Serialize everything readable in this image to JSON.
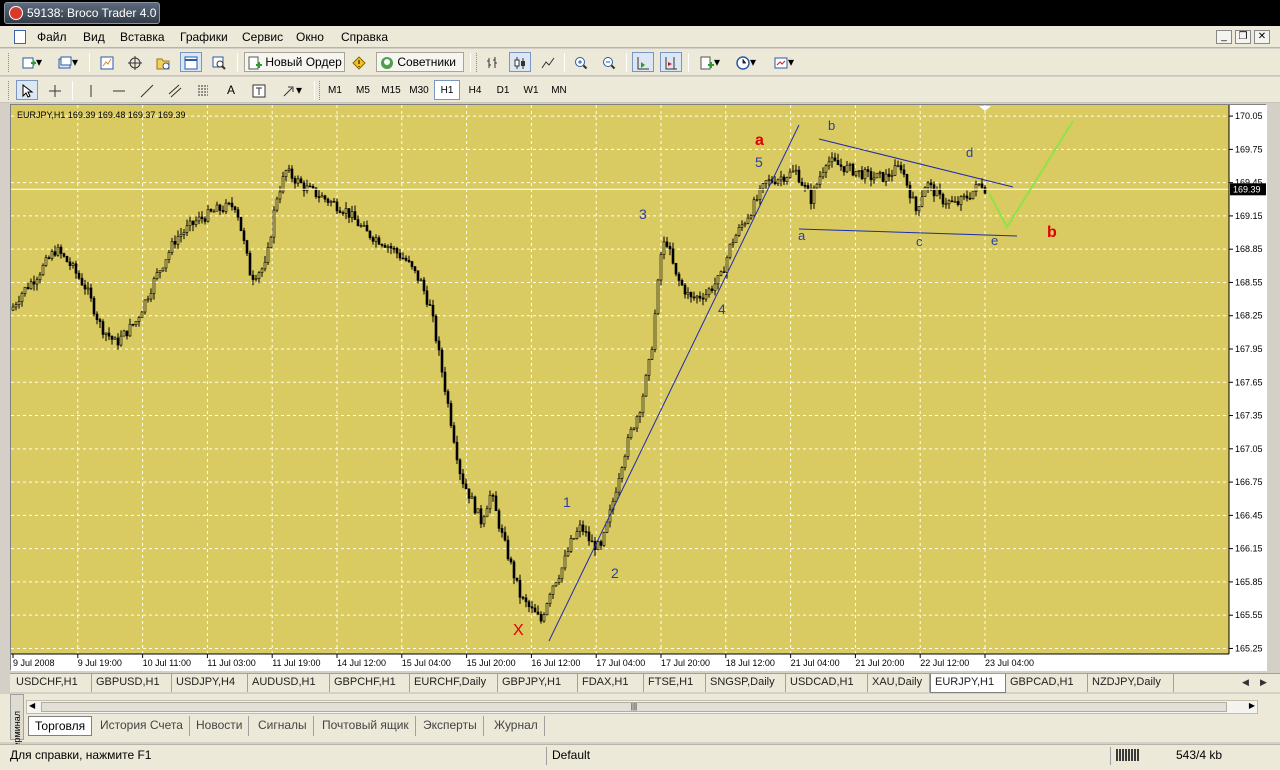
{
  "window": {
    "title": "59138: Broco Trader 4.0"
  },
  "menu": [
    "Файл",
    "Вид",
    "Вставка",
    "Графики",
    "Сервис",
    "Окно",
    "Справка"
  ],
  "toolbar": {
    "new_order": "Новый Ордер",
    "experts": "Советники"
  },
  "timeframes": [
    "M1",
    "M5",
    "M15",
    "M30",
    "H1",
    "H4",
    "D1",
    "W1",
    "MN"
  ],
  "active_timeframe": "H1",
  "chart_data": {
    "type": "candlestick",
    "header": "EURJPY,H1  169.39 169.48 169.37 169.39",
    "symbol": "EURJPY",
    "timeframe": "H1",
    "ohlc": {
      "open": 169.39,
      "high": 169.48,
      "low": 169.37,
      "close": 169.39
    },
    "current_price_label": "169.39",
    "y_ticks": [
      "170.05",
      "169.75",
      "169.45",
      "169.15",
      "168.85",
      "168.55",
      "168.25",
      "167.95",
      "167.65",
      "167.35",
      "167.05",
      "166.75",
      "166.45",
      "166.15",
      "165.85",
      "165.55",
      "165.25"
    ],
    "ylim": [
      165.2,
      170.15
    ],
    "x_ticks": [
      "9 Jul 2008",
      "9 Jul 19:00",
      "10 Jul 11:00",
      "11 Jul 03:00",
      "11 Jul 19:00",
      "14 Jul 12:00",
      "15 Jul 04:00",
      "15 Jul 20:00",
      "16 Jul 12:00",
      "17 Jul 04:00",
      "17 Jul 20:00",
      "18 Jul 12:00",
      "21 Jul 04:00",
      "21 Jul 20:00",
      "22 Jul 12:00",
      "23 Jul 04:00"
    ],
    "price_path": [
      [
        0,
        168.3
      ],
      [
        10,
        168.45
      ],
      [
        25,
        168.6
      ],
      [
        45,
        168.85
      ],
      [
        60,
        168.7
      ],
      [
        75,
        168.5
      ],
      [
        90,
        168.15
      ],
      [
        105,
        168.0
      ],
      [
        125,
        168.2
      ],
      [
        145,
        168.6
      ],
      [
        165,
        168.95
      ],
      [
        185,
        169.1
      ],
      [
        205,
        169.2
      ],
      [
        225,
        169.25
      ],
      [
        240,
        168.6
      ],
      [
        255,
        168.7
      ],
      [
        265,
        169.3
      ],
      [
        275,
        169.55
      ],
      [
        295,
        169.4
      ],
      [
        315,
        169.3
      ],
      [
        335,
        169.2
      ],
      [
        355,
        169.0
      ],
      [
        375,
        168.9
      ],
      [
        395,
        168.75
      ],
      [
        410,
        168.55
      ],
      [
        420,
        168.3
      ],
      [
        430,
        167.8
      ],
      [
        440,
        167.3
      ],
      [
        450,
        166.8
      ],
      [
        460,
        166.6
      ],
      [
        470,
        166.4
      ],
      [
        480,
        166.65
      ],
      [
        490,
        166.3
      ],
      [
        500,
        166.0
      ],
      [
        510,
        165.7
      ],
      [
        520,
        165.6
      ],
      [
        530,
        165.5
      ],
      [
        540,
        165.8
      ],
      [
        550,
        165.95
      ],
      [
        560,
        166.2
      ],
      [
        570,
        166.35
      ],
      [
        580,
        166.2
      ],
      [
        590,
        166.15
      ],
      [
        600,
        166.5
      ],
      [
        610,
        166.9
      ],
      [
        620,
        167.2
      ],
      [
        630,
        167.45
      ],
      [
        640,
        167.9
      ],
      [
        650,
        168.8
      ],
      [
        655,
        168.95
      ],
      [
        665,
        168.6
      ],
      [
        680,
        168.4
      ],
      [
        695,
        168.45
      ],
      [
        710,
        168.6
      ],
      [
        720,
        168.9
      ],
      [
        730,
        169.05
      ],
      [
        740,
        169.2
      ],
      [
        755,
        169.45
      ],
      [
        770,
        169.5
      ],
      [
        785,
        169.55
      ],
      [
        800,
        169.3
      ],
      [
        815,
        169.65
      ],
      [
        830,
        169.6
      ],
      [
        845,
        169.55
      ],
      [
        860,
        169.5
      ],
      [
        875,
        169.5
      ],
      [
        890,
        169.6
      ],
      [
        905,
        169.2
      ],
      [
        915,
        169.45
      ],
      [
        930,
        169.3
      ],
      [
        945,
        169.25
      ],
      [
        960,
        169.35
      ],
      [
        970,
        169.45
      ],
      [
        975,
        169.39
      ]
    ],
    "annotations": [
      {
        "text": "a",
        "color": "#e00000",
        "bold": true
      },
      {
        "text": "b",
        "color": "#e00000",
        "bold": true
      },
      {
        "text": "X",
        "color": "#e00000",
        "bold": false
      },
      {
        "text": "1",
        "color": "#2a3fa8"
      },
      {
        "text": "2",
        "color": "#2a3fa8"
      },
      {
        "text": "3",
        "color": "#2a3fa8"
      },
      {
        "text": "4",
        "color": "#2a3fa8"
      },
      {
        "text": "5",
        "color": "#2a3fa8"
      },
      {
        "text": "a",
        "color": "#2a3fa8"
      },
      {
        "text": "b",
        "color": "#2a3fa8"
      },
      {
        "text": "c",
        "color": "#2a3fa8"
      },
      {
        "text": "d",
        "color": "#2a3fa8"
      },
      {
        "text": "e",
        "color": "#2a3fa8"
      }
    ],
    "colors": {
      "background": "#d9ca62",
      "grid": "#ffffff",
      "candles": "#000000",
      "trendlines": "#1e2bb0",
      "projection": "#8fe34a",
      "price_line": "#ffffff",
      "price_label_bg": "#000000"
    }
  },
  "symbol_tabs": [
    "USDCHF,H1",
    "GBPUSD,H1",
    "USDJPY,H4",
    "AUDUSD,H1",
    "GBPCHF,H1",
    "EURCHF,Daily",
    "GBPJPY,H1",
    "FDAX,H1",
    "FTSE,H1",
    "SNGSP,Daily",
    "USDCAD,H1",
    "XAU,Daily",
    "EURJPY,H1",
    "GBPCAD,H1",
    "NZDJPY,Daily"
  ],
  "active_symbol_tab": "EURJPY,H1",
  "terminal": {
    "side_label": "Терминал",
    "tabs": [
      "Торговля",
      "История Счета",
      "Новости",
      "Сигналы",
      "Почтовый ящик",
      "Эксперты",
      "Журнал"
    ],
    "active_tab": "Торговля"
  },
  "status": {
    "help": "Для справки, нажмите F1",
    "profile": "Default",
    "traffic": "543/4 kb"
  }
}
